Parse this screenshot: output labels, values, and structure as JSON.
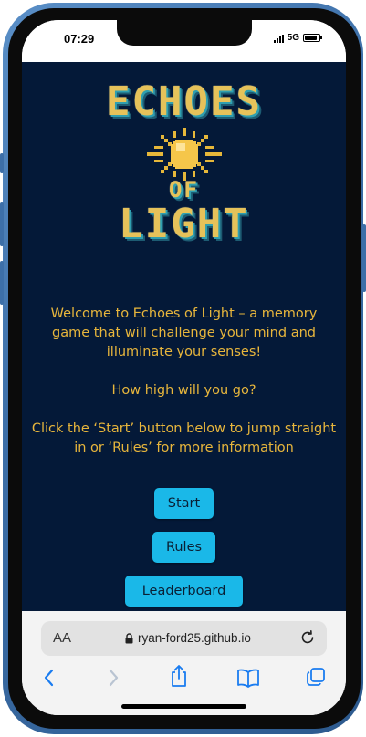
{
  "status_bar": {
    "time": "07:29",
    "network": "5G",
    "battery_level": 0.85
  },
  "logo": {
    "line1": "ECHOES",
    "line2": "OF",
    "line3": "LIGHT"
  },
  "intro": {
    "paragraph1": "Welcome to Echoes of Light – a memory game that will challenge your mind and illuminate your senses!",
    "paragraph2": "How high will you go?",
    "paragraph3": "Click the ‘Start’ button below to jump straight in or ‘Rules’ for more information"
  },
  "buttons": {
    "start": "Start",
    "rules": "Rules",
    "leaderboard": "Leaderboard"
  },
  "browser": {
    "text_size_label": "AA",
    "url": "ryan-ford25.github.io",
    "icons": [
      "back-icon",
      "forward-icon",
      "share-icon",
      "bookmarks-icon",
      "tabs-icon"
    ]
  },
  "colors": {
    "page_background": "#041938",
    "text": "#e8b63c",
    "button": "#1ab8e8",
    "logo_gold": "#e6c25a",
    "logo_teal": "#2f9fb0",
    "phone_frame": "#3d6fa8"
  }
}
